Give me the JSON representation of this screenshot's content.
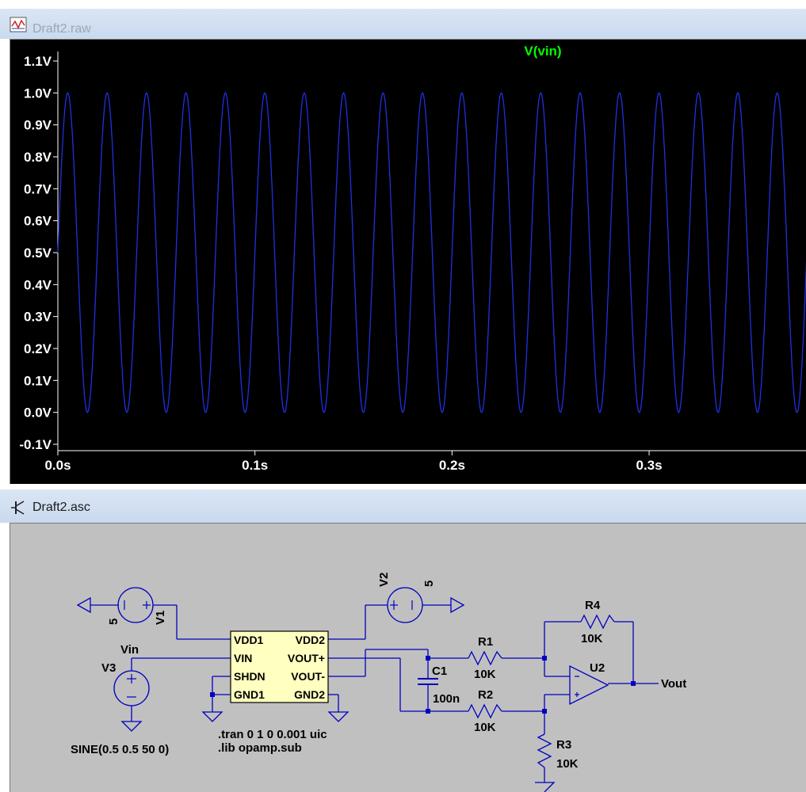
{
  "plot_window": {
    "title": "Draft2.raw",
    "icon": "waveform-icon"
  },
  "schematic_window": {
    "title": "Draft2.asc",
    "icon": "component-icon"
  },
  "chart_data": {
    "type": "line",
    "title": "V(vin)",
    "trace_color": "#2030e0",
    "title_color": "#00ff00",
    "xlabel": "",
    "ylabel": "",
    "xlim": [
      0.0,
      0.38
    ],
    "ylim": [
      -0.1,
      1.1
    ],
    "x_ticks": [
      "0.0s",
      "0.1s",
      "0.2s",
      "0.3s"
    ],
    "y_ticks": [
      "1.1V",
      "1.0V",
      "0.9V",
      "0.8V",
      "0.7V",
      "0.6V",
      "0.5V",
      "0.4V",
      "0.3V",
      "0.2V",
      "0.1V",
      "0.0V",
      "-0.1V"
    ],
    "signal": {
      "offset": 0.5,
      "amplitude": 0.5,
      "frequency_hz": 50,
      "phase": 0
    },
    "grid": false
  },
  "schematic": {
    "v1": {
      "name": "V1",
      "value": "5"
    },
    "v2": {
      "name": "V2",
      "value": "5"
    },
    "v3": {
      "name": "V3",
      "value": "SINE(0.5 0.5 50 0)",
      "net": "Vin"
    },
    "ic_pins_left": [
      "VDD1",
      "VIN",
      "SHDN",
      "GND1"
    ],
    "ic_pins_right": [
      "VDD2",
      "VOUT+",
      "VOUT-",
      "GND2"
    ],
    "c1": {
      "name": "C1",
      "value": "100n"
    },
    "r1": {
      "name": "R1",
      "value": "10K"
    },
    "r2": {
      "name": "R2",
      "value": "10K"
    },
    "r3": {
      "name": "R3",
      "value": "10K"
    },
    "r4": {
      "name": "R4",
      "value": "10K"
    },
    "opamp": {
      "name": "U2"
    },
    "out_net": "Vout",
    "directive_tran": ".tran 0 1 0 0.001 uic",
    "directive_lib": ".lib opamp.sub",
    "wire_color": "#0000c0"
  }
}
